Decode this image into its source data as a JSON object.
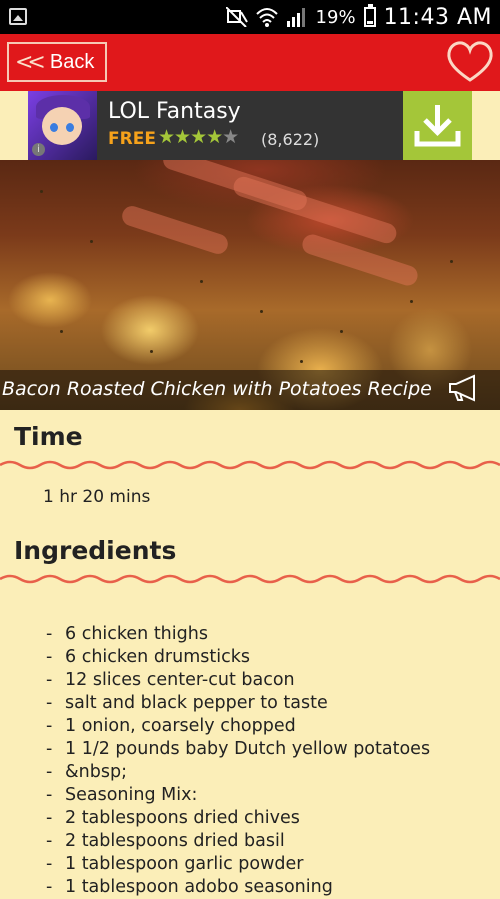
{
  "status_bar": {
    "battery": "19%",
    "time": "11:43 AM",
    "icons": [
      "image-icon",
      "mute-icon",
      "wifi-icon",
      "signal-icon",
      "battery-icon"
    ]
  },
  "app_bar": {
    "back_label": "Back",
    "icons": [
      "chevron-double-left-icon",
      "heart-icon"
    ]
  },
  "ad": {
    "title": "LOL Fantasy",
    "price": "FREE",
    "rating": 4,
    "rating_count": "(8,622)",
    "icons": [
      "download-icon",
      "info-icon"
    ]
  },
  "hero": {
    "caption": "Bacon Roasted Chicken with Potatoes Recipe",
    "icons": [
      "megaphone-icon"
    ]
  },
  "sections": {
    "time_title": "Time",
    "time_value": "1 hr 20 mins",
    "ingredients_title": "Ingredients"
  },
  "ingredients": [
    "6 chicken thighs",
    "6 chicken drumsticks",
    "12 slices center-cut bacon",
    "salt and black pepper to taste",
    "1 onion, coarsely chopped",
    "1 1/2 pounds baby Dutch yellow potatoes",
    "&nbsp;",
    "Seasoning Mix:",
    "2 tablespoons dried chives",
    "2 tablespoons dried basil",
    "1 tablespoon garlic powder",
    "1 tablespoon adobo seasoning"
  ],
  "colors": {
    "app_bar": "#e0181b",
    "background": "#fbeeb8",
    "wave": "#e8604a",
    "ad_download": "#a4c639",
    "ad_free": "#f6a21b"
  }
}
